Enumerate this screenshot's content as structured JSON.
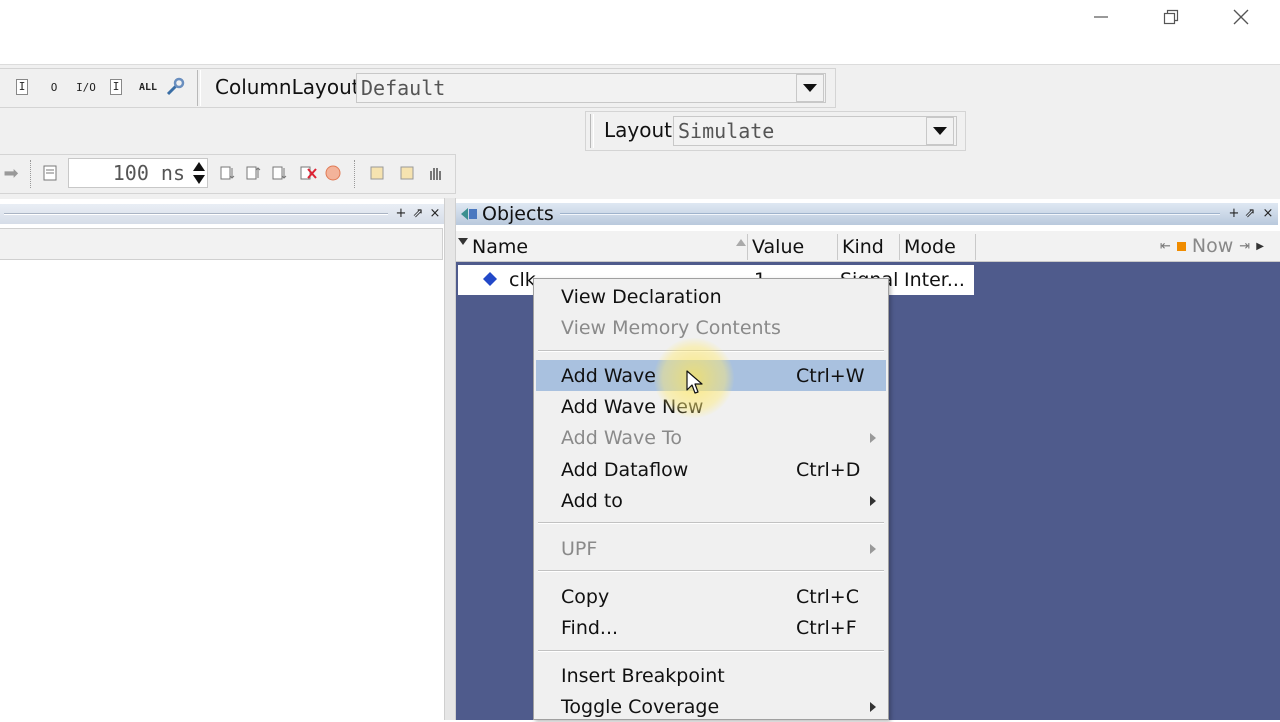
{
  "window": {
    "minimize_icon": "minimize-icon",
    "restore_icon": "restore-icon",
    "close_icon": "close-icon"
  },
  "toolbar1": {
    "buttons": [
      "I",
      "O",
      "I/O",
      "I",
      "ALL"
    ],
    "column_layout_label": "ColumnLayout",
    "column_layout_value": "Default"
  },
  "toolbar2": {
    "layout_label": "Layout",
    "layout_value": "Simulate"
  },
  "toolbar3": {
    "run_time_value": "100 ns"
  },
  "objects_pane": {
    "title": "Objects",
    "columns": [
      "Name",
      "Value",
      "Kind",
      "Mode"
    ],
    "now_label": "Now",
    "row": {
      "name": "clk",
      "value": "1",
      "kind": "Signal",
      "mode": "Inter..."
    }
  },
  "context_menu": {
    "view_declaration": "View Declaration",
    "view_memory_contents": "View Memory Contents",
    "add_wave": "Add Wave",
    "add_wave_shortcut": "Ctrl+W",
    "add_wave_new": "Add Wave New",
    "add_wave_to": "Add Wave To",
    "add_dataflow": "Add Dataflow",
    "add_dataflow_shortcut": "Ctrl+D",
    "add_to": "Add to",
    "upf": "UPF",
    "copy": "Copy",
    "copy_shortcut": "Ctrl+C",
    "find": "Find...",
    "find_shortcut": "Ctrl+F",
    "insert_breakpoint": "Insert Breakpoint",
    "toggle_coverage": "Toggle Coverage"
  },
  "colors": {
    "objects_background": "#4f5b8c",
    "menu_highlight": "#a9c1df",
    "menu_background": "#f0f0f0"
  }
}
